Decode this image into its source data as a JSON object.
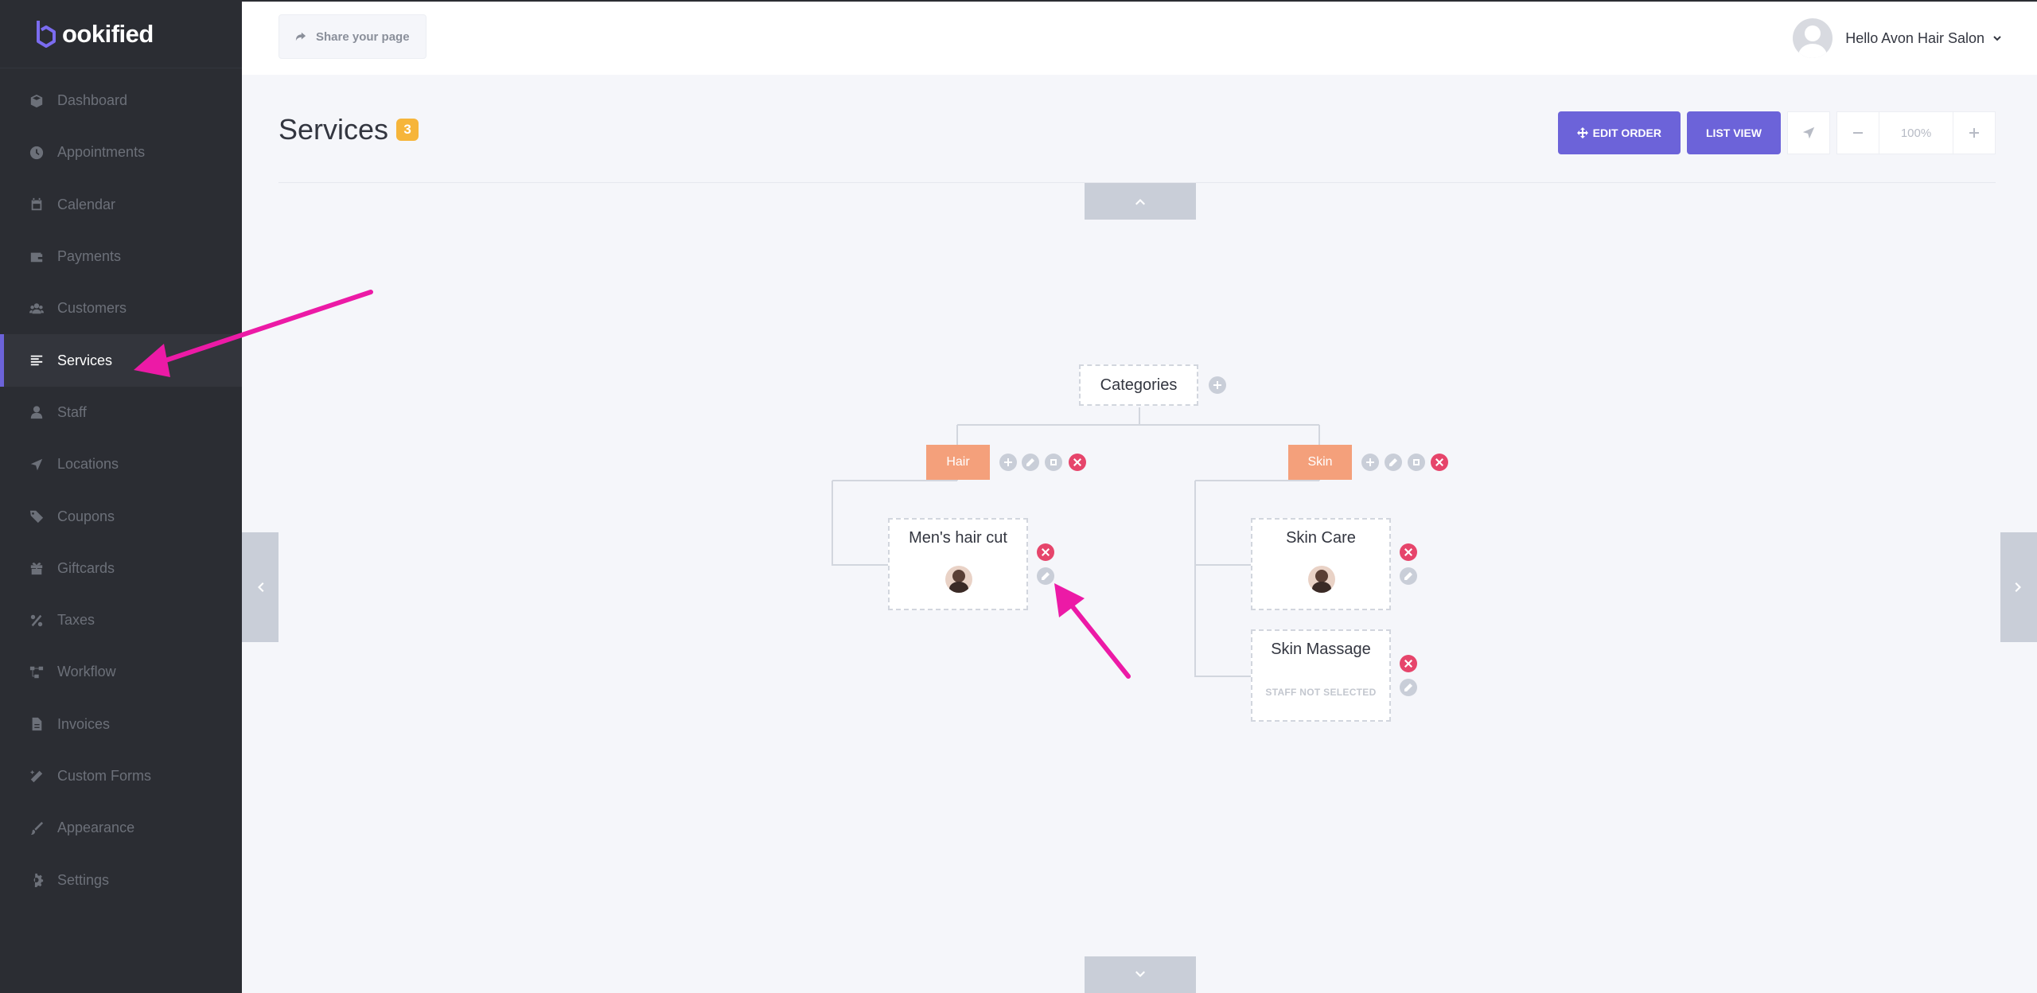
{
  "app": {
    "logo_text": "ookified"
  },
  "sidebar": {
    "items": [
      {
        "label": "Dashboard",
        "icon": "cube-icon"
      },
      {
        "label": "Appointments",
        "icon": "clock-icon"
      },
      {
        "label": "Calendar",
        "icon": "calendar-icon"
      },
      {
        "label": "Payments",
        "icon": "wallet-icon"
      },
      {
        "label": "Customers",
        "icon": "users-icon"
      },
      {
        "label": "Services",
        "icon": "list-icon",
        "active": true
      },
      {
        "label": "Staff",
        "icon": "user-icon"
      },
      {
        "label": "Locations",
        "icon": "location-arrow-icon"
      },
      {
        "label": "Coupons",
        "icon": "tag-icon"
      },
      {
        "label": "Giftcards",
        "icon": "gift-icon"
      },
      {
        "label": "Taxes",
        "icon": "percent-icon"
      },
      {
        "label": "Workflow",
        "icon": "workflow-icon"
      },
      {
        "label": "Invoices",
        "icon": "file-icon"
      },
      {
        "label": "Custom Forms",
        "icon": "magic-wand-icon"
      },
      {
        "label": "Appearance",
        "icon": "brush-icon"
      },
      {
        "label": "Settings",
        "icon": "gear-icon"
      }
    ]
  },
  "header": {
    "share_label": "Share your page",
    "user_greeting": "Hello Avon Hair Salon"
  },
  "page": {
    "title": "Services",
    "count": "3"
  },
  "toolbar": {
    "edit_order_label": "EDIT ORDER",
    "list_view_label": "LIST VIEW",
    "zoom": "100%"
  },
  "tree": {
    "root_label": "Categories",
    "categories": [
      {
        "label": "Hair"
      },
      {
        "label": "Skin"
      }
    ],
    "services": [
      {
        "name": "Men's hair cut",
        "staff": "photo"
      },
      {
        "name": "Skin Care",
        "staff": "photo"
      },
      {
        "name": "Skin Massage",
        "staff_text": "STAFF NOT SELECTED"
      }
    ]
  },
  "colors": {
    "accent": "#6c63d9",
    "category": "#f4a07b",
    "danger": "#e6456b",
    "annotation": "#ec1aa6",
    "badge": "#f6b53a"
  }
}
